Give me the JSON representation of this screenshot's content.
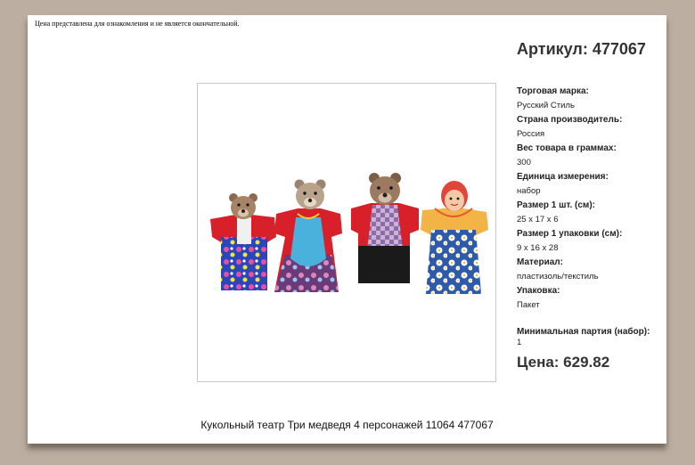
{
  "disclaimer": "Цена представлена для ознакомления и не является окончательной.",
  "article": "Артикул: 477067",
  "specs": [
    {
      "label": "Торговая марка:",
      "value": "Русский Стиль"
    },
    {
      "label": "Страна производитель:",
      "value": "Россия"
    },
    {
      "label": "Вес товара в граммах:",
      "value": "300"
    },
    {
      "label": "Единица измерения:",
      "value": "набор"
    },
    {
      "label": "Размер 1 шт. (см):",
      "value": "25 х 17 х 6"
    },
    {
      "label": "Размер 1 упаковки (см):",
      "value": "9 х 16 х 28"
    },
    {
      "label": "Материал:",
      "value": "пластизоль/текстиль"
    },
    {
      "label": "Упаковка:",
      "value": "Пакет"
    }
  ],
  "min_batch": {
    "label": "Минимальная партия (набор):",
    "value": "1"
  },
  "price": "Цена: 629.82",
  "caption": "Кукольный театр Три медведя 4 персонажей 11064 477067",
  "colors": {
    "background": "#bcaea1",
    "sheet": "#ffffff",
    "puppet_red": "#d7202a",
    "floral_blue": "#2b46b8"
  }
}
